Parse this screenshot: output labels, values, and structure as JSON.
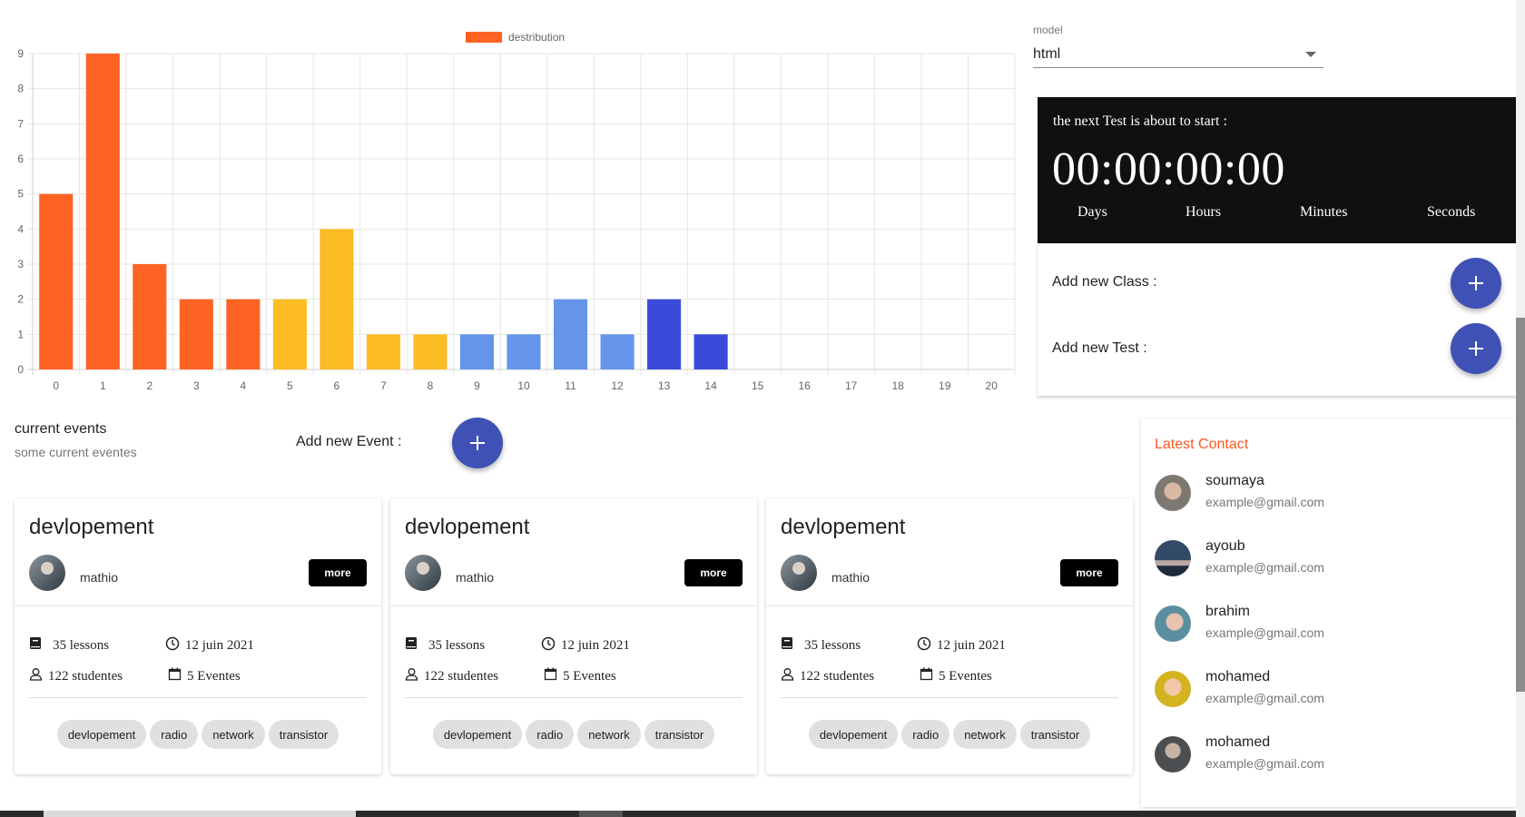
{
  "chart_data": {
    "type": "bar",
    "categories": [
      "0",
      "1",
      "2",
      "3",
      "4",
      "5",
      "6",
      "7",
      "8",
      "9",
      "10",
      "11",
      "12",
      "13",
      "14",
      "15",
      "16",
      "17",
      "18",
      "19",
      "20"
    ],
    "series": [
      {
        "name": "destribution",
        "values": [
          5,
          9,
          3,
          2,
          2,
          2,
          4,
          1,
          1,
          1,
          1,
          2,
          1,
          2,
          1,
          0,
          0,
          0,
          0,
          0,
          0
        ]
      }
    ],
    "bar_colors": [
      "#ff6324",
      "#ff6324",
      "#ff6324",
      "#ff6324",
      "#ff6324",
      "#fbbc24",
      "#fbbc24",
      "#fbbc24",
      "#fbbc24",
      "#6495ea",
      "#6495ea",
      "#6495ea",
      "#6495ea",
      "#3b4bd9",
      "#3b4bd9",
      "#3b4bd9",
      "#3b4bd9",
      "#3b4bd9",
      "#3b4bd9",
      "#3b4bd9",
      "#3b4bd9"
    ],
    "ylim": [
      0,
      9
    ],
    "yticks": [
      "0",
      "1",
      "2",
      "3",
      "4",
      "5",
      "6",
      "7",
      "8",
      "9"
    ],
    "grid": true,
    "legend_position": "top-center"
  },
  "model": {
    "label": "model",
    "value": "html"
  },
  "countdown": {
    "title": "the next Test is about to start :",
    "timer": "00:00:00:00",
    "units": [
      "Days",
      "Hours",
      "Minutes",
      "Seconds"
    ]
  },
  "actions": {
    "add_class": "Add new Class :",
    "add_test": "Add new Test :",
    "add_event": "Add new Event :"
  },
  "events": {
    "title": "current events",
    "subtitle": "some current eventes",
    "cards": [
      {
        "title": "devlopement",
        "author": "mathio",
        "more": "more",
        "lessons": "35 lessons",
        "date": "12 juin 2021",
        "students": "122 studentes",
        "events": "5 Eventes",
        "tags": [
          "devlopement",
          "radio",
          "network",
          "transistor"
        ]
      },
      {
        "title": "devlopement",
        "author": "mathio",
        "more": "more",
        "lessons": "35 lessons",
        "date": "12 juin 2021",
        "students": "122 studentes",
        "events": "5 Eventes",
        "tags": [
          "devlopement",
          "radio",
          "network",
          "transistor"
        ]
      },
      {
        "title": "devlopement",
        "author": "mathio",
        "more": "more",
        "lessons": "35 lessons",
        "date": "12 juin 2021",
        "students": "122 studentes",
        "events": "5 Eventes",
        "tags": [
          "devlopement",
          "radio",
          "network",
          "transistor"
        ]
      }
    ]
  },
  "contacts": {
    "title": "Latest Contact",
    "items": [
      {
        "name": "soumaya",
        "email": "example@gmail.com"
      },
      {
        "name": "ayoub",
        "email": "example@gmail.com"
      },
      {
        "name": "brahim",
        "email": "example@gmail.com"
      },
      {
        "name": "mohamed",
        "email": "example@gmail.com"
      },
      {
        "name": "mohamed",
        "email": "example@gmail.com"
      }
    ]
  },
  "colors": {
    "accent": "#3f51b5",
    "contact_title": "#ff5722",
    "countdown_bg": "#101010"
  }
}
